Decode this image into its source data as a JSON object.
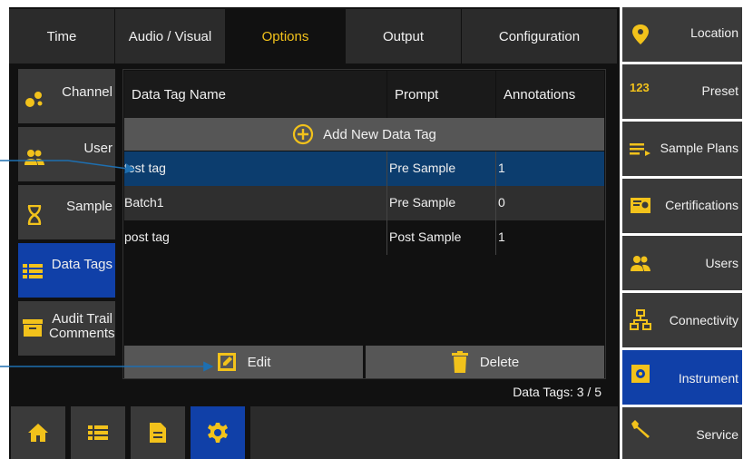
{
  "tabs": [
    {
      "label": "Time"
    },
    {
      "label": "Audio / Visual"
    },
    {
      "label": "Options",
      "active": true
    },
    {
      "label": "Output"
    },
    {
      "label": "Configuration"
    }
  ],
  "left_nav": [
    {
      "label": "Channel",
      "icon": "channel-icon"
    },
    {
      "label": "User",
      "icon": "users-icon"
    },
    {
      "label": "Sample",
      "icon": "hourglass-icon"
    },
    {
      "label": "Data Tags",
      "icon": "list-icon",
      "active": true
    },
    {
      "label": "Audit Trail Comments",
      "icon": "comment-box-icon"
    }
  ],
  "table": {
    "columns": [
      "Data Tag Name",
      "Prompt",
      "Annotations"
    ],
    "add_label": "Add New Data Tag",
    "rows": [
      {
        "name": "test tag",
        "prompt": "Pre Sample",
        "annotations": "1",
        "selected": true
      },
      {
        "name": "Batch1",
        "prompt": "Pre Sample",
        "annotations": "0"
      },
      {
        "name": "post tag",
        "prompt": "Post Sample",
        "annotations": "1"
      }
    ],
    "edit_label": "Edit",
    "delete_label": "Delete",
    "count_label": "Data Tags: 3 / 5"
  },
  "right_nav": [
    {
      "label": "Location",
      "icon": "location-pin-icon"
    },
    {
      "label": "Preset",
      "icon": "preset-123-icon"
    },
    {
      "label": "Sample Plans",
      "icon": "sample-plans-icon"
    },
    {
      "label": "Certifications",
      "icon": "certificate-icon"
    },
    {
      "label": "Users",
      "icon": "users-icon"
    },
    {
      "label": "Connectivity",
      "icon": "network-icon"
    },
    {
      "label": "Instrument",
      "icon": "instrument-icon",
      "active": true
    },
    {
      "label": "Service",
      "icon": "wrench-icon"
    }
  ],
  "bottom_nav": [
    {
      "icon": "home-icon"
    },
    {
      "icon": "list-icon"
    },
    {
      "icon": "document-icon"
    },
    {
      "icon": "gear-icon",
      "active": true
    }
  ],
  "colors": {
    "accent": "#f2c21b",
    "active_blue": "#1040a8",
    "selected_row": "#0c3d6e",
    "annotation_arrow": "#1e6fb0"
  }
}
